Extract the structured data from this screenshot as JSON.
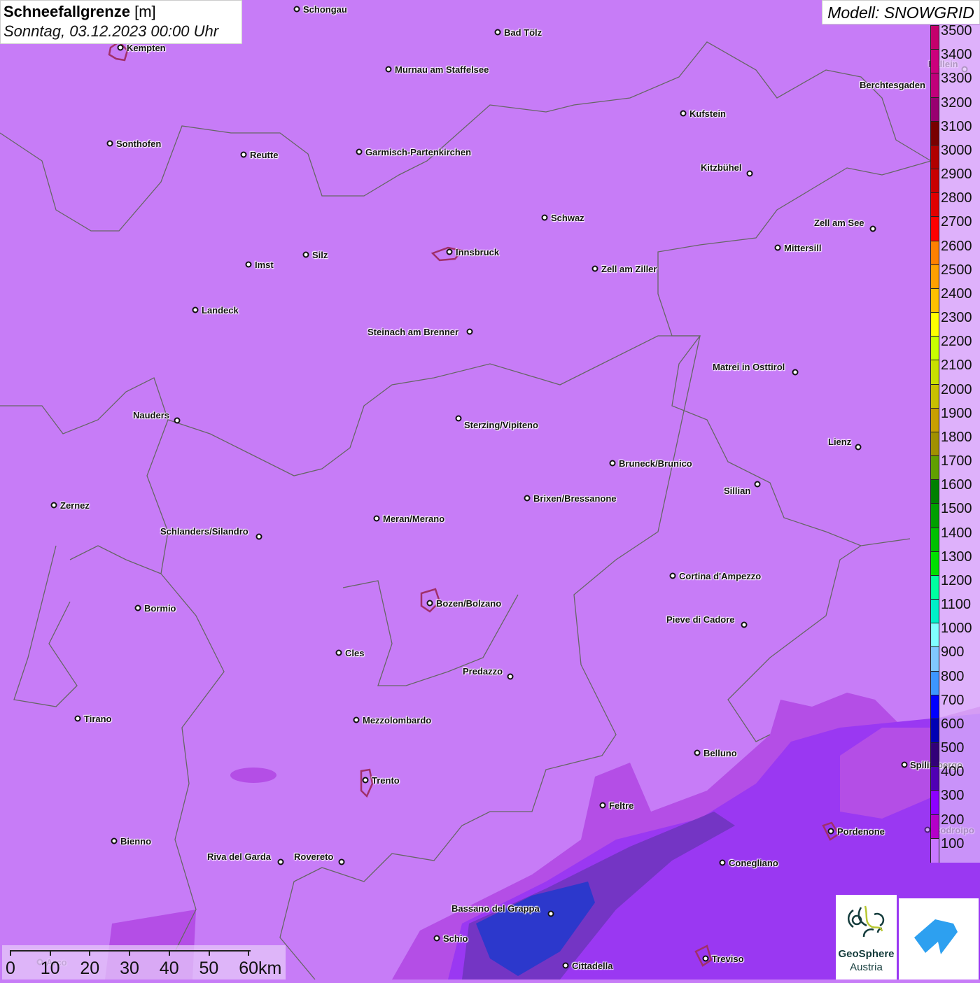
{
  "header": {
    "title": "Schneefallgrenze",
    "unit": "[m]",
    "datetime": "Sonntag, 03.12.2023 00:00 Uhr",
    "model": "Modell: SNOWGRID"
  },
  "legend": {
    "labels": [
      "3500",
      "3400",
      "3300",
      "3200",
      "3100",
      "3000",
      "2900",
      "2800",
      "2700",
      "2600",
      "2500",
      "2400",
      "2300",
      "2200",
      "2100",
      "2000",
      "1900",
      "1800",
      "1700",
      "1600",
      "1500",
      "1400",
      "1300",
      "1200",
      "1100",
      "1000",
      "900",
      "800",
      "700",
      "600",
      "500",
      "400",
      "300",
      "200",
      "100"
    ],
    "colors": [
      "#c4006c",
      "#cc007c",
      "#c0007a",
      "#980070",
      "#780000",
      "#b00000",
      "#c80000",
      "#e00000",
      "#ff0000",
      "#ff8000",
      "#ffa000",
      "#ffc000",
      "#ffff00",
      "#c8ff00",
      "#c8e000",
      "#c8c000",
      "#c8a000",
      "#a09000",
      "#60a000",
      "#008000",
      "#00a000",
      "#00c000",
      "#00e000",
      "#00ffa0",
      "#00f0c8",
      "#80ffff",
      "#80c8ff",
      "#3c96ff",
      "#0000ff",
      "#0000b4",
      "#320078",
      "#5000b4",
      "#8c00ff",
      "#b400c8",
      "#c878ff"
    ]
  },
  "cities": [
    "Schongau",
    "Bad Tölz",
    "Kempten",
    "Murnau am Staffelsee",
    "Hallein",
    "Berchtesgaden",
    "Kufstein",
    "Sonthofen",
    "Reutte",
    "Garmisch-Partenkirchen",
    "Kitzbühel",
    "Schwaz",
    "Zell am See",
    "Mittersill",
    "Innsbruck",
    "Silz",
    "Imst",
    "Zell am Ziller",
    "Landeck",
    "Steinach am Brenner",
    "Matrei in Osttirol",
    "Nauders",
    "Sterzing/Vipiteno",
    "Lienz",
    "Bruneck/Brunico",
    "Sillian",
    "Brixen/Bressanone",
    "Zernez",
    "Meran/Merano",
    "Schlanders/Silandro",
    "Cortina d'Ampezzo",
    "Bozen/Bolzano",
    "Bormio",
    "Pieve di Cadore",
    "Cles",
    "Predazzo",
    "Tirano",
    "Mezzolombardo",
    "Belluno",
    "Spilimbergo",
    "Trento",
    "Feltre",
    "Pordenone",
    "Codroipo",
    "Bienno",
    "Riva del Garda",
    "Rovereto",
    "Conegliano",
    "Bassano del Grappa",
    "Schio",
    "Treviso",
    "Cittadella",
    "Arco"
  ],
  "scale": {
    "labels": [
      "0",
      "10",
      "20",
      "30",
      "40",
      "50",
      "60km"
    ]
  },
  "logos": {
    "geosphere_line1": "GeoSphere",
    "geosphere_line2": "Austria"
  }
}
